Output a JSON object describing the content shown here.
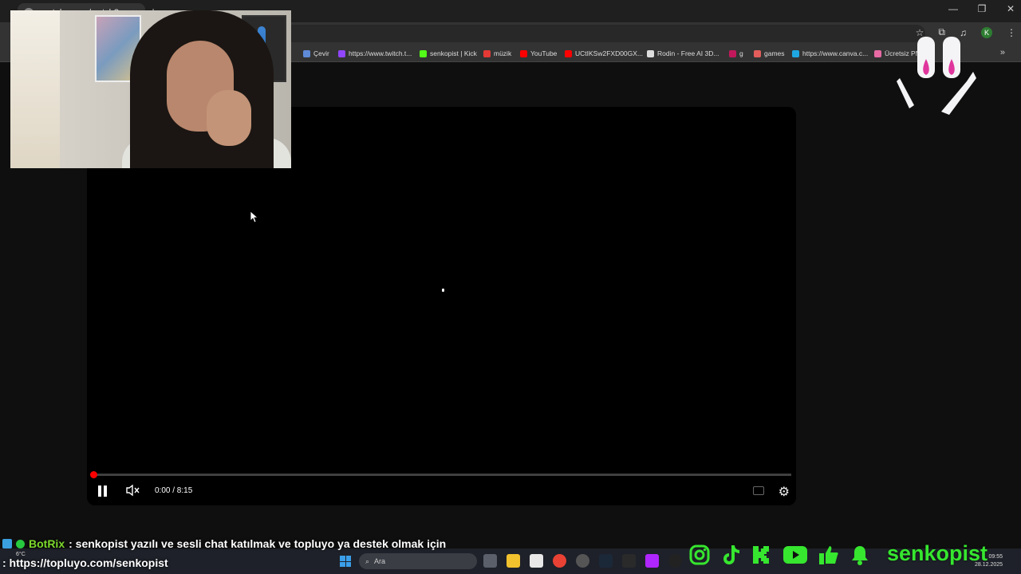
{
  "browser": {
    "tab_title": "youtube.com/watch?v=DPzCi...",
    "bookmarks": [
      {
        "label": "Çevir",
        "color": "#5f8ad8"
      },
      {
        "label": "https://www.twitch.t...",
        "color": "#9146ff"
      },
      {
        "label": "senkopist | Kick",
        "color": "#53fc18"
      },
      {
        "label": "müzik",
        "color": "#e53935"
      },
      {
        "label": "YouTube",
        "color": "#ff0000"
      },
      {
        "label": "UCtIKSw2FXD00GX...",
        "color": "#ff0000"
      },
      {
        "label": "Rodin - Free AI 3D...",
        "color": "#dddddd"
      },
      {
        "label": "g",
        "color": "#c2185b"
      },
      {
        "label": "games",
        "color": "#e35d5b"
      },
      {
        "label": "https://www.canva.c...",
        "color": "#1ea7e1"
      },
      {
        "label": "Ücretsiz PNG...",
        "color": "#e76aa5"
      }
    ],
    "profile_initial": "K"
  },
  "player": {
    "time": "0:00 / 8:15",
    "progress_fraction": 0.004
  },
  "overlay": {
    "bot_name": "BotRix",
    "chat_message": ": senkopist yazılı ve sesli chat katılmak ve topluyo ya destek olmak için",
    "chat_link": ": https://topluyo.com/senkopist",
    "brand_name": "senkopist"
  },
  "taskbar": {
    "search_placeholder": "Ara",
    "weather": "6°C",
    "time": "09:55",
    "date": "28.12.2025"
  }
}
